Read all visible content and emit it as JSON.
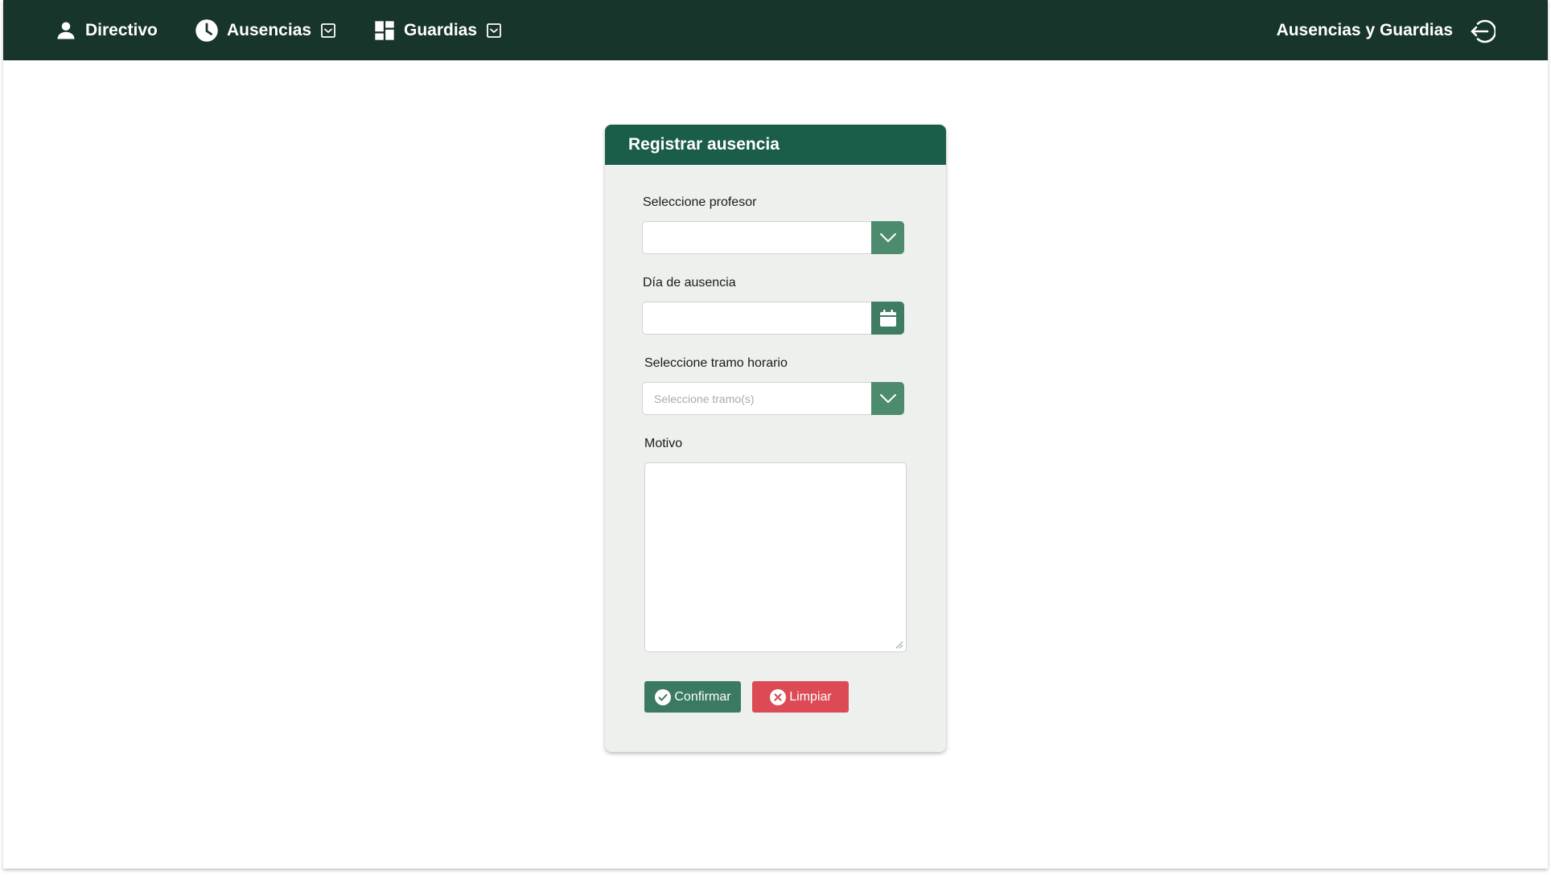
{
  "nav": {
    "directivo": {
      "label": "Directivo",
      "icon": "user-icon"
    },
    "ausencias": {
      "label": "Ausencias",
      "icon": "clock-icon"
    },
    "guardias": {
      "label": "Guardias",
      "icon": "dashboard-icon"
    },
    "brand": "Ausencias y Guardias",
    "logout_icon": "logout-icon"
  },
  "form": {
    "title": "Registrar ausencia",
    "profesor": {
      "label": "Seleccione profesor",
      "value": ""
    },
    "dia": {
      "label": "Día de ausencia",
      "value": ""
    },
    "tramo": {
      "label": "Seleccione tramo horario",
      "placeholder": "Seleccione tramo(s)"
    },
    "motivo": {
      "label": "Motivo",
      "value": ""
    },
    "confirm_label": "Confirmar",
    "clear_label": "Limpiar"
  },
  "colors": {
    "topbar": "#17352a",
    "card_header": "#1b5d4b",
    "addon": "#4d8b6e",
    "confirm": "#3a7a60",
    "clear": "#dc4b55"
  }
}
